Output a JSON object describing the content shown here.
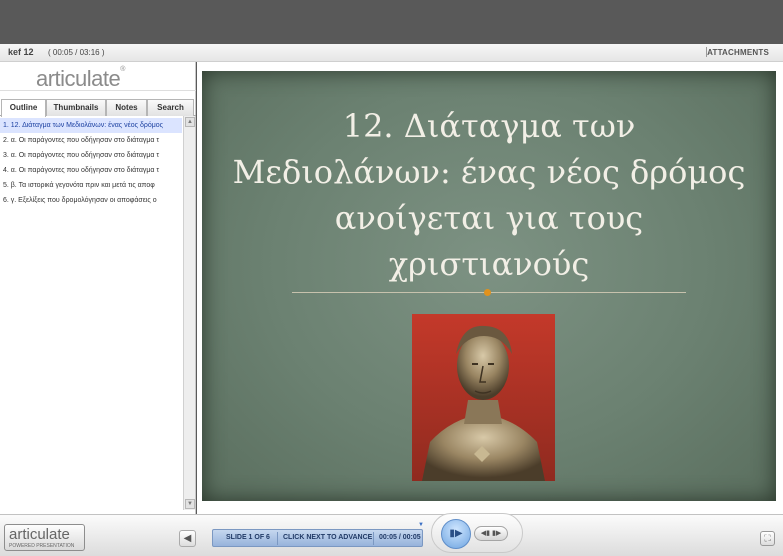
{
  "player": {
    "title": "kef 12",
    "time": "( 00:05 / 03:16 )",
    "attachments_label": "ATTACHMENTS"
  },
  "sidebar": {
    "logo": "articulate",
    "logo_mark": "®",
    "tabs": [
      {
        "label": "Outline",
        "active": true
      },
      {
        "label": "Thumbnails"
      },
      {
        "label": "Notes"
      },
      {
        "label": "Search"
      }
    ],
    "outline": [
      "1.  12. Διάταγμα των Μεδιολάνων: ένας νέος δρόμος",
      "2.  α. Οι παράγοντες που οδήγησαν στο διάταγμα τ",
      "3.  α. Οι παράγοντες που οδήγησαν στο διάταγμα τ",
      "4.  α. Οι παράγοντες που οδήγησαν στο διάταγμα τ",
      "5.  β. Τα ιστορικά γεγονότα πριν και μετά τις αποφ",
      "6.  γ. Εξελίξεις που δρομολόγησαν οι αποφάσεις ο"
    ],
    "selected_index": 0
  },
  "slide": {
    "title": "12. Διάταγμα των Μεδιολάνων: ένας νέος δρόμος ανοίγεται για τους χριστιανούς",
    "accent_color": "#e0921e",
    "background_color": "#6b8171"
  },
  "controls": {
    "logo_text": "articulate",
    "logo_subtext": "POWERED PRESENTATION",
    "slide_counter": "SLIDE 1 OF 6",
    "advance_hint": "CLICK NEXT TO ADVANCE",
    "slide_time": "00:05 / 00:05",
    "play_icon": "play-icon",
    "prev_icon": "prev-icon",
    "next_icon": "next-icon",
    "volume_icon": "volume-icon",
    "fullscreen_icon": "fullscreen-icon"
  }
}
